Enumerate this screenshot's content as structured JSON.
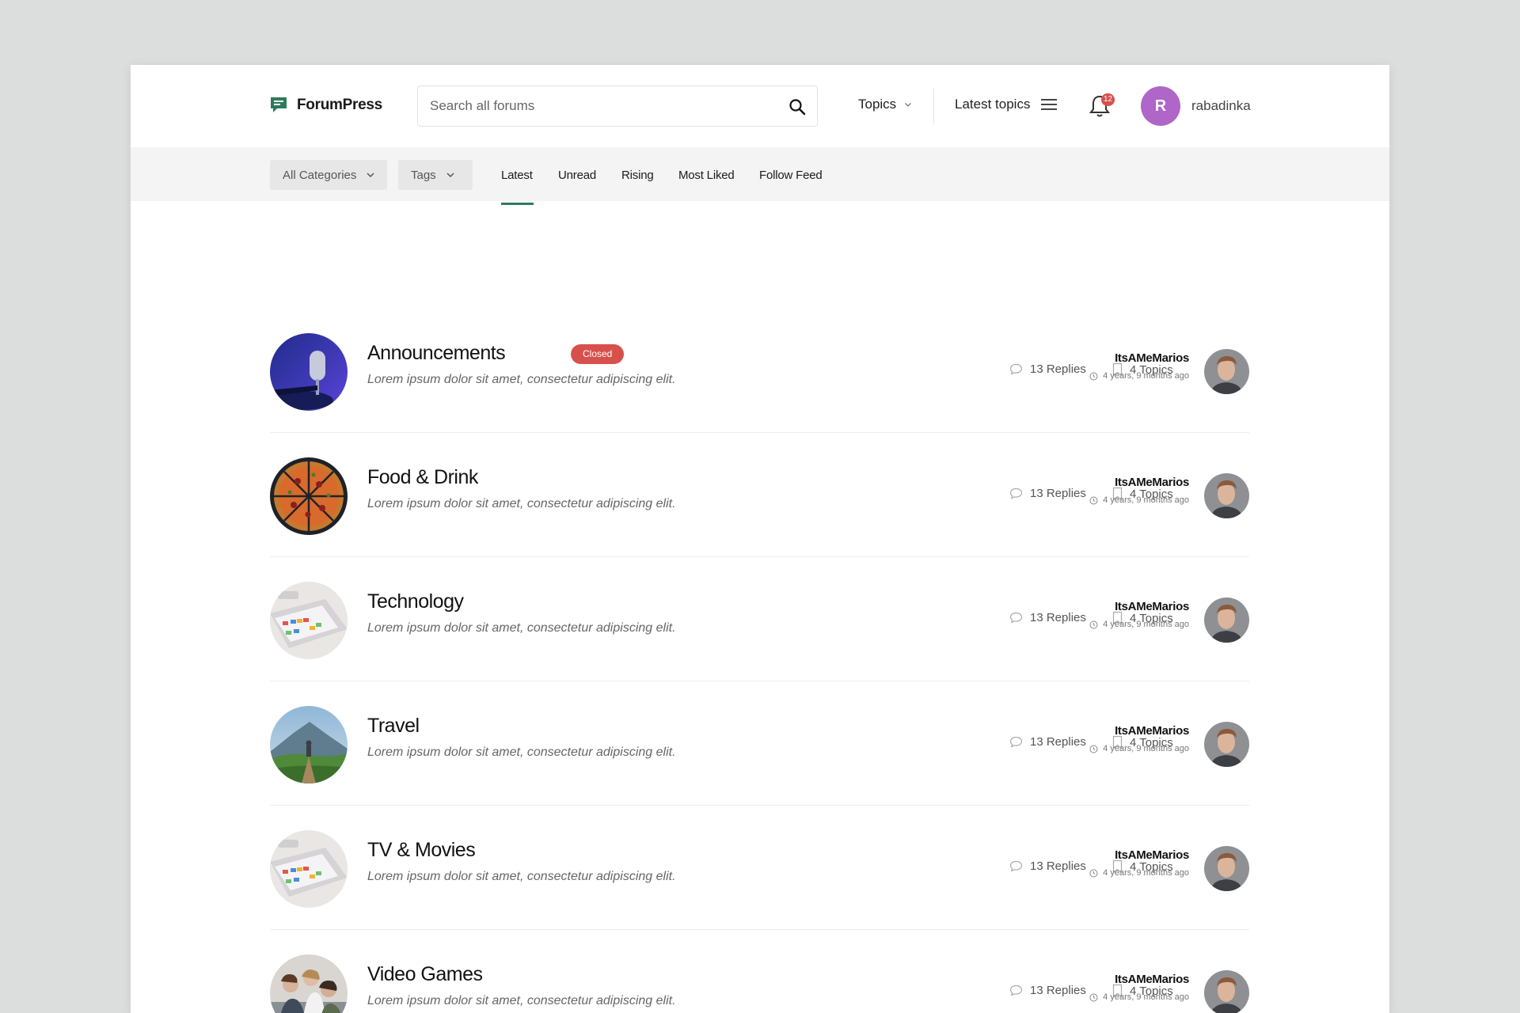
{
  "header": {
    "brand": "ForumPress",
    "search_placeholder": "Search all forums",
    "topics_label": "Topics",
    "latest_topics_label": "Latest topics",
    "notification_count": "12",
    "user_initial": "R",
    "username": "rabadinka",
    "colors": {
      "brand_green": "#2f7a5b",
      "avatar_purple": "#b065c8",
      "badge_red": "#d8504c"
    }
  },
  "subnav": {
    "category_filter": "All Categories",
    "tags_filter": "Tags",
    "tabs": [
      "Latest",
      "Unread",
      "Rising",
      "Most Liked",
      "Follow Feed"
    ],
    "active_tab": "Latest"
  },
  "forums": [
    {
      "title": "Announcements",
      "badge": "Closed",
      "description": "Lorem ipsum dolor sit amet, consectetur adipiscing elit.",
      "replies": "13 Replies",
      "topics": "4 Topics",
      "last_user": "ItsAMeMarios",
      "last_time": "4 years, 9 months ago",
      "thumb": "microphone-image"
    },
    {
      "title": "Food & Drink",
      "description": "Lorem ipsum dolor sit amet, consectetur adipiscing elit.",
      "replies": "13 Replies",
      "topics": "4 Topics",
      "last_user": "ItsAMeMarios",
      "last_time": "4 years, 9 months ago",
      "thumb": "pizza-image"
    },
    {
      "title": "Technology",
      "description": "Lorem ipsum dolor sit amet, consectetur adipiscing elit.",
      "replies": "13 Replies",
      "topics": "4 Topics",
      "last_user": "ItsAMeMarios",
      "last_time": "4 years, 9 months ago",
      "thumb": "device-image"
    },
    {
      "title": "Travel",
      "description": "Lorem ipsum dolor sit amet, consectetur adipiscing elit.",
      "replies": "13 Replies",
      "topics": "4 Topics",
      "last_user": "ItsAMeMarios",
      "last_time": "4 years, 9 months ago",
      "thumb": "mountain-image"
    },
    {
      "title": "TV & Movies",
      "description": "Lorem ipsum dolor sit amet, consectetur adipiscing elit.",
      "replies": "13 Replies",
      "topics": "4 Topics",
      "last_user": "ItsAMeMarios",
      "last_time": "4 years, 9 months ago",
      "thumb": "device-image"
    },
    {
      "title": "Video Games",
      "description": "Lorem ipsum dolor sit amet, consectetur adipiscing elit.",
      "replies": "13 Replies",
      "topics": "4 Topics",
      "last_user": "ItsAMeMarios",
      "last_time": "4 years, 9 months ago",
      "thumb": "people-image"
    }
  ]
}
